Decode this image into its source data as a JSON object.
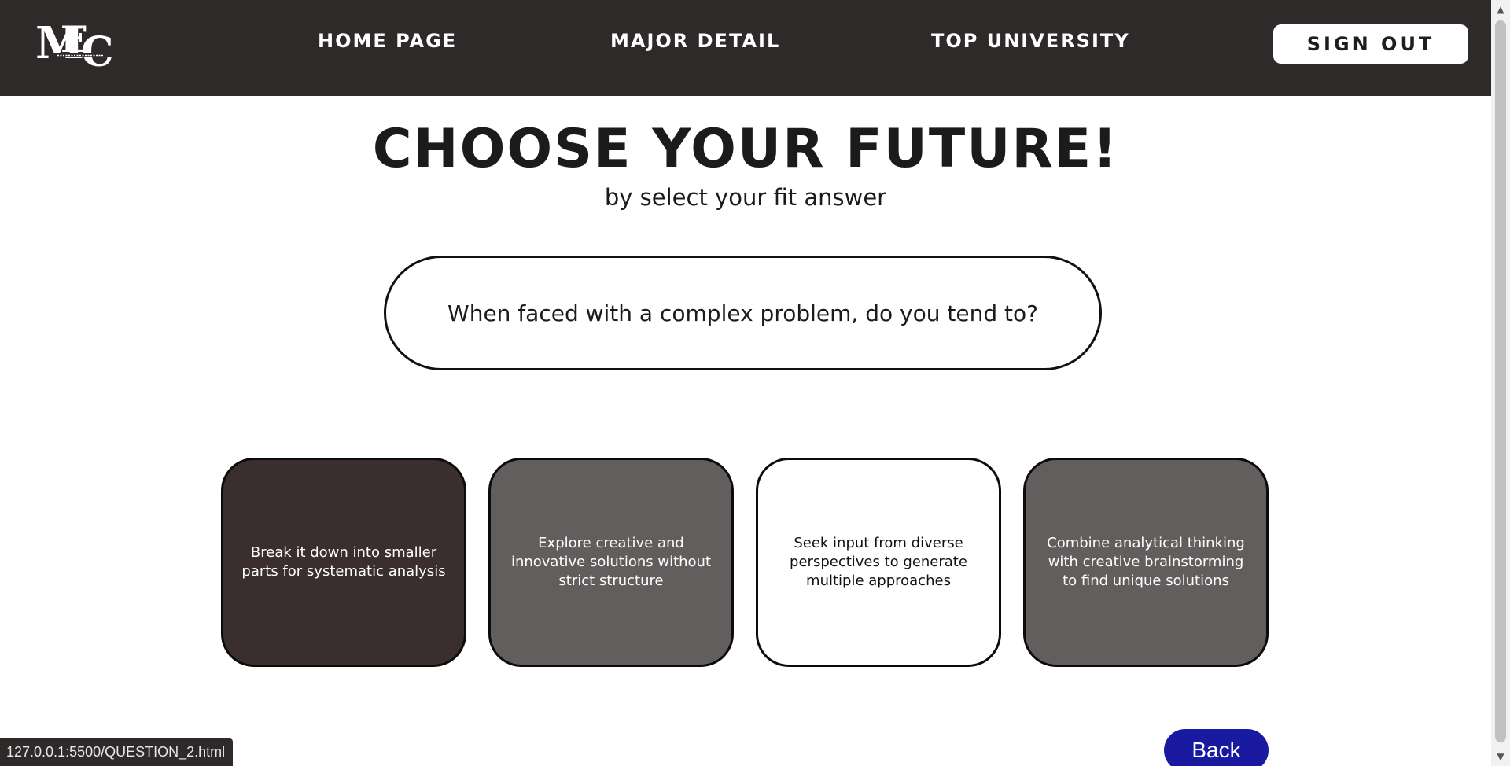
{
  "nav": {
    "logo_alt": "MEC",
    "links": [
      "HOME PAGE",
      "MAJOR DETAIL",
      "TOP UNIVERSITY"
    ],
    "signout_label": "SIGN OUT"
  },
  "main": {
    "title": "CHOOSE YOUR FUTURE!",
    "subtitle": "by select your fit answer",
    "question": "When faced with a complex problem, do you tend to?",
    "answers": [
      "Break it down into smaller parts for systematic analysis",
      "Explore creative and innovative solutions without strict structure",
      "Seek input from diverse perspectives to generate multiple approaches",
      "Combine analytical thinking with creative brainstorming to find unique solutions"
    ],
    "back_label": "Back"
  },
  "status": {
    "url": "127.0.0.1:5500/QUESTION_2.html"
  },
  "colors": {
    "navbar": "#2e2a29",
    "card_dark": "#3a2f2e",
    "card_grey": "#625e5d",
    "back_button": "#1a1aa0"
  }
}
